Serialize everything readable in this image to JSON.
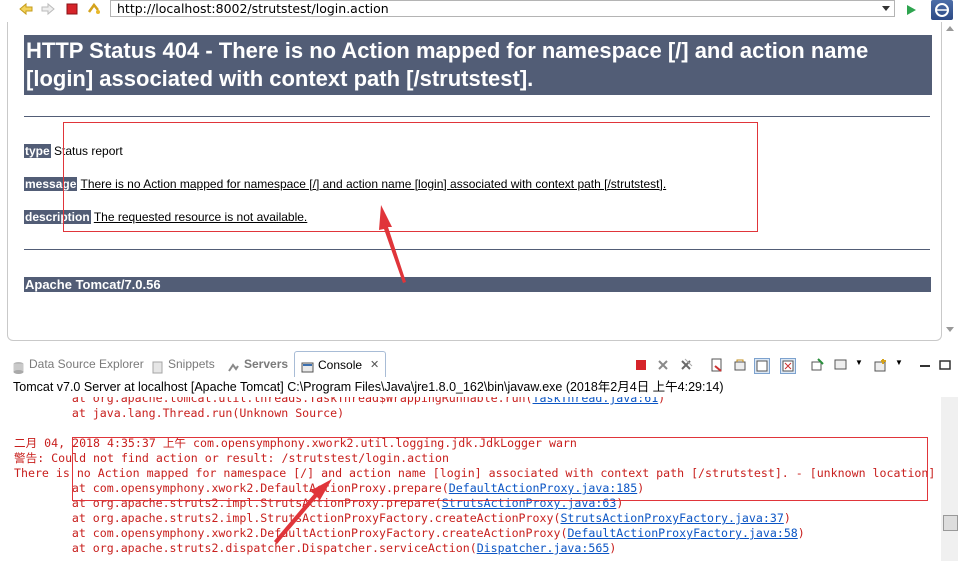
{
  "browser": {
    "url": "http://localhost:8002/strutstest/login.action"
  },
  "page": {
    "title": "HTTP Status 404 - There is no Action mapped for namespace [/] and action name [login] associated with context path [/strutstest].",
    "type_label": "type",
    "type_value": "Status report",
    "message_label": "message",
    "message_value": "There is no Action mapped for namespace [/] and action name [login] associated with context path [/strutstest].",
    "description_label": "description",
    "description_value": "The requested resource is not available.",
    "footer": "Apache Tomcat/7.0.56"
  },
  "console_view": {
    "tabs": [
      {
        "label": "Data Source Explorer"
      },
      {
        "label": "Snippets"
      },
      {
        "label": "Servers"
      },
      {
        "label": "Console"
      }
    ],
    "title": "Tomcat v7.0 Server at localhost [Apache Tomcat] C:\\Program Files\\Java\\jre1.8.0_162\\bin\\javaw.exe (2018年2月4日 上午4:29:14)",
    "lines": [
      {
        "text": "        at org.apache.tomcat.util.threads.TaskThread$WrappingRunnable.run(",
        "link": "TaskThread.java:61",
        "end": ")"
      },
      {
        "text": "        at java.lang.Thread.run(Unknown Source)",
        "link": "",
        "end": ""
      },
      {
        "text": "",
        "link": "",
        "end": ""
      },
      {
        "text": "二月 04, 2018 4:35:37 上午 com.opensymphony.xwork2.util.logging.jdk.JdkLogger warn",
        "link": "",
        "end": ""
      },
      {
        "text": "警告: Could not find action or result: /strutstest/login.action",
        "link": "",
        "end": ""
      },
      {
        "text": "There is no Action mapped for namespace [/] and action name [login] associated with context path [/strutstest]. - [unknown location]",
        "link": "",
        "end": ""
      },
      {
        "text": "        at com.opensymphony.xwork2.DefaultActionProxy.prepare(",
        "link": "DefaultActionProxy.java:185",
        "end": ")"
      },
      {
        "text": "        at org.apache.struts2.impl.StrutsActionProxy.prepare(",
        "link": "StrutsActionProxy.java:63",
        "end": ")"
      },
      {
        "text": "        at org.apache.struts2.impl.StrutsActionProxyFactory.createActionProxy(",
        "link": "StrutsActionProxyFactory.java:37",
        "end": ")"
      },
      {
        "text": "        at com.opensymphony.xwork2.DefaultActionProxyFactory.createActionProxy(",
        "link": "DefaultActionProxyFactory.java:58",
        "end": ")"
      },
      {
        "text": "        at org.apache.struts2.dispatcher.Dispatcher.serviceAction(",
        "link": "Dispatcher.java:565",
        "end": ")"
      }
    ]
  },
  "colors": {
    "tomcat_header": "#525d76",
    "console_error": "#c8201e",
    "console_link": "#0b55c4",
    "annotation": "#e0353a"
  }
}
